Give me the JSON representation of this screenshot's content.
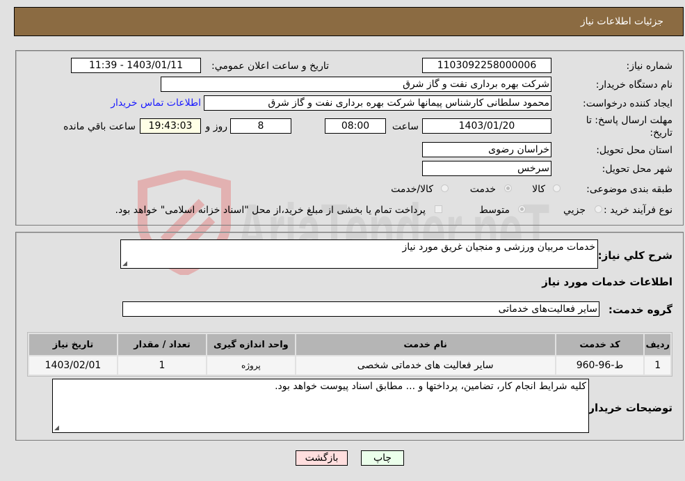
{
  "header": {
    "title": "جزئیات اطلاعات نیاز"
  },
  "form": {
    "need_number_label": "شماره نیاز:",
    "need_number": "1103092258000006",
    "announce_label": "تاريخ و ساعت اعلان عمومي:",
    "announce_value": "1403/01/11 - 11:39",
    "buyer_org_label": "نام دستگاه خريدار:",
    "buyer_org": "شرکت بهره برداری نفت و گاز شرق",
    "creator_label": "ايجاد کننده درخواست:",
    "creator": "محمود سلطانی کارشناس پیمانها شرکت بهره برداری نفت و گاز شرق",
    "contact_link": "اطلاعات تماس خريدار",
    "deadline_label": "مهلت ارسال پاسخ: تا تاریخ:",
    "deadline_date": "1403/01/20",
    "time_label": "ساعت",
    "deadline_time": "08:00",
    "days": "8",
    "days_label": "روز و",
    "remaining": "19:43:03",
    "remaining_label": "ساعت باقي مانده",
    "province_label": "استان محل تحويل:",
    "province": "خراسان رضوی",
    "city_label": "شهر محل تحويل:",
    "city": "سرخس",
    "category_label": "طبقه بندی موضوعی:",
    "category_options": [
      "کالا",
      "خدمت",
      "کالا/خدمت"
    ],
    "category_selected": "خدمت",
    "process_label": "نوع فرآيند خريد :",
    "process_options": [
      "جزيي",
      "متوسط"
    ],
    "process_selected": "متوسط",
    "treasury_note": "پرداخت تمام یا بخشی از مبلغ خرید،از محل \"اسناد خزانه اسلامی\" خواهد بود."
  },
  "details": {
    "summary_label": "شرح کلي نياز:",
    "summary": "خدمات مربیان ورزشی و منجیان غریق مورد نیاز",
    "services_heading": "اطلاعات خدمات مورد نياز",
    "service_group_label": "گروه خدمت:",
    "service_group": "سایر فعالیت‌های خدماتی",
    "table": {
      "headers": [
        "رديف",
        "کد خدمت",
        "نام خدمت",
        "واحد اندازه گيری",
        "تعداد / مقدار",
        "تاريخ نياز"
      ],
      "rows": [
        [
          "1",
          "ط-96-960",
          "سایر فعالیت های خدماتی شخصی",
          "پروژه",
          "1",
          "1403/02/01"
        ]
      ]
    },
    "buyer_notes_label": "توضيحات خريدار:",
    "buyer_notes": "کلیه شرایط انجام کار، تضامین، پرداختها و ... مطابق اسناد پیوست خواهد بود."
  },
  "buttons": {
    "print": "چاپ",
    "back": "بازگشت"
  },
  "watermark": {
    "text": "AriaTender.neT"
  },
  "colors": {
    "header_bg": "#8b6b42",
    "print_bg": "#ebffeb",
    "back_bg": "#ffdede",
    "link": "#1a1aff"
  }
}
